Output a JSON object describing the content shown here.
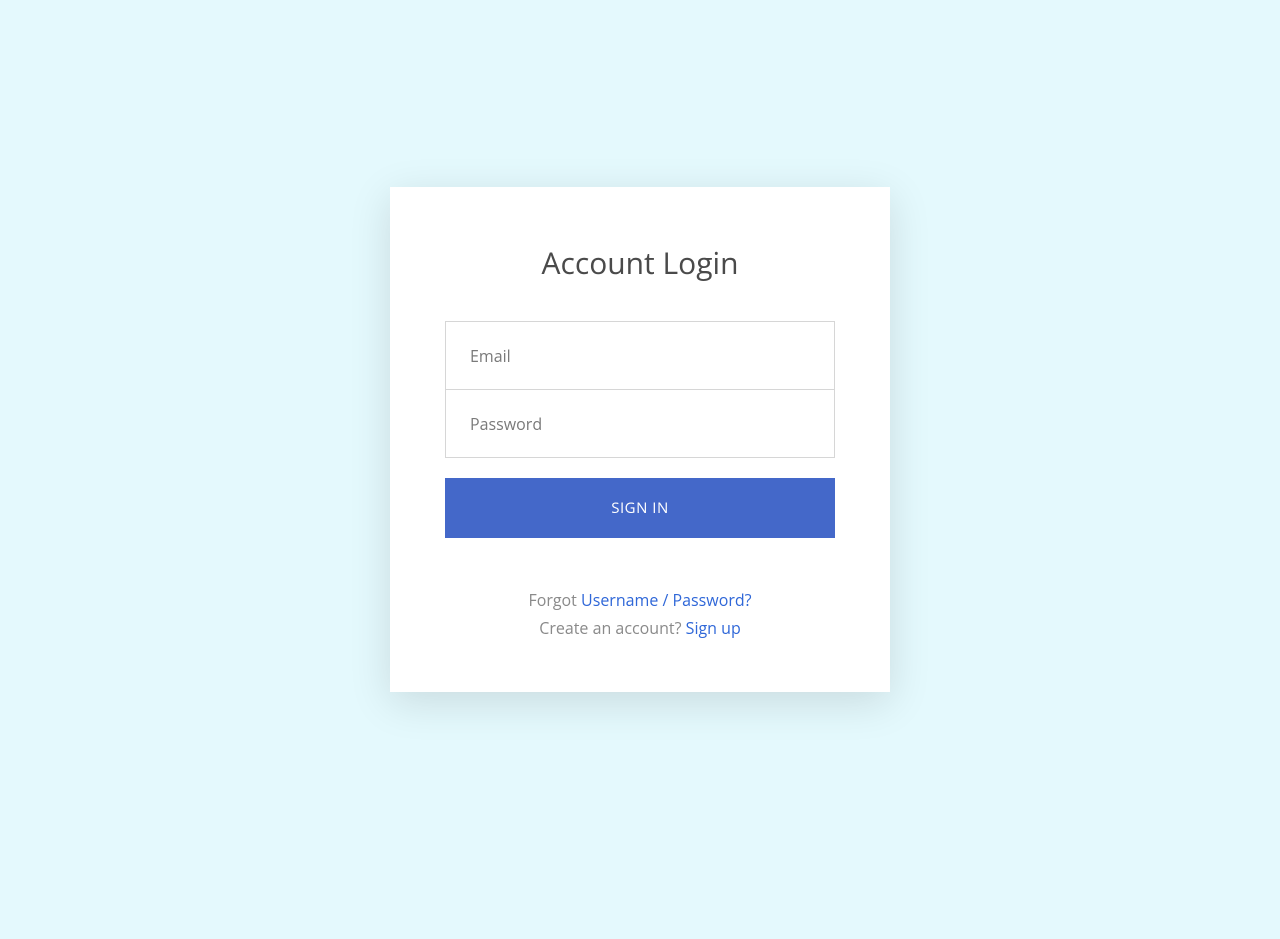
{
  "login": {
    "title": "Account Login",
    "email_placeholder": "Email",
    "password_placeholder": "Password",
    "signin_button": "SIGN IN",
    "forgot_prefix": "Forgot ",
    "forgot_link": "Username / Password?",
    "signup_prefix": "Create an account? ",
    "signup_link": "Sign up"
  }
}
